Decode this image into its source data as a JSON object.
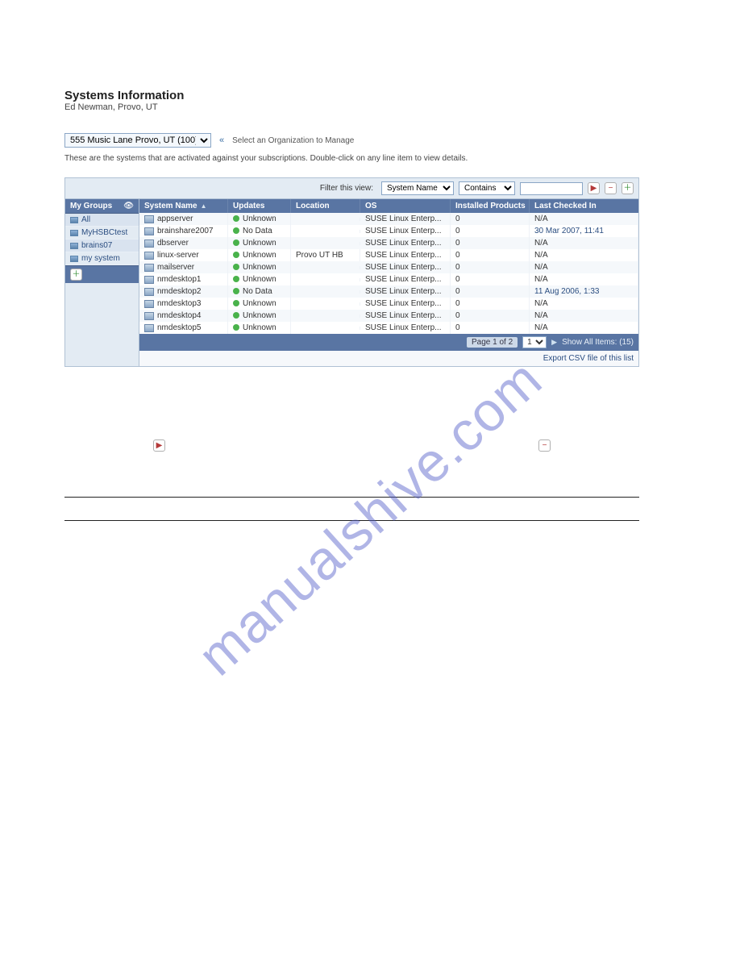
{
  "page": {
    "title": "Systems Information",
    "subtitle": "Ed Newman, Provo, UT"
  },
  "org": {
    "selected": "555 Music Lane Provo, UT (100)",
    "hint": "Select an Organization to Manage"
  },
  "description": "These are the systems that are activated against your subscriptions. Double-click on any line item to view details.",
  "filter": {
    "label": "Filter this view:",
    "field_selected": "System Name",
    "op_selected": "Contains",
    "value": ""
  },
  "sidebar": {
    "header": "My Groups",
    "items": [
      {
        "label": "All"
      },
      {
        "label": "MyHSBCtest"
      },
      {
        "label": "brains07"
      },
      {
        "label": "my system"
      }
    ]
  },
  "table": {
    "columns": {
      "system_name": "System Name",
      "updates": "Updates",
      "location": "Location",
      "os": "OS",
      "installed_products": "Installed Products",
      "last_checked": "Last Checked In"
    },
    "rows": [
      {
        "name": "appserver",
        "update": "Unknown",
        "loc": "",
        "os": "SUSE Linux Enterp...",
        "ip": "0",
        "last": "N/A"
      },
      {
        "name": "brainshare2007",
        "update": "No Data",
        "loc": "",
        "os": "SUSE Linux Enterp...",
        "ip": "0",
        "last": "30 Mar 2007, 11:41"
      },
      {
        "name": "dbserver",
        "update": "Unknown",
        "loc": "",
        "os": "SUSE Linux Enterp...",
        "ip": "0",
        "last": "N/A"
      },
      {
        "name": "linux-server",
        "update": "Unknown",
        "loc": "Provo UT HB",
        "os": "SUSE Linux Enterp...",
        "ip": "0",
        "last": "N/A"
      },
      {
        "name": "mailserver",
        "update": "Unknown",
        "loc": "",
        "os": "SUSE Linux Enterp...",
        "ip": "0",
        "last": "N/A"
      },
      {
        "name": "nmdesktop1",
        "update": "Unknown",
        "loc": "",
        "os": "SUSE Linux Enterp...",
        "ip": "0",
        "last": "N/A"
      },
      {
        "name": "nmdesktop2",
        "update": "No Data",
        "loc": "",
        "os": "SUSE Linux Enterp...",
        "ip": "0",
        "last": "11 Aug 2006, 1:33"
      },
      {
        "name": "nmdesktop3",
        "update": "Unknown",
        "loc": "",
        "os": "SUSE Linux Enterp...",
        "ip": "0",
        "last": "N/A"
      },
      {
        "name": "nmdesktop4",
        "update": "Unknown",
        "loc": "",
        "os": "SUSE Linux Enterp...",
        "ip": "0",
        "last": "N/A"
      },
      {
        "name": "nmdesktop5",
        "update": "Unknown",
        "loc": "",
        "os": "SUSE Linux Enterp...",
        "ip": "0",
        "last": "N/A"
      }
    ]
  },
  "pagination": {
    "page_label": "Page 1 of 2",
    "current": "1",
    "show_all": "Show All Items: (15)"
  },
  "export_label": "Export CSV file of this list",
  "watermark": "manualshive.com"
}
